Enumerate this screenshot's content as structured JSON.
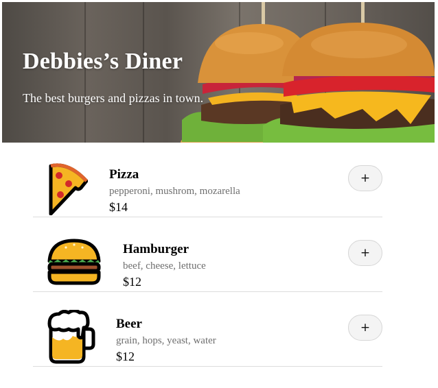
{
  "hero": {
    "title": "Debbies’s Diner",
    "subtitle": "The best burgers and pizzas in town."
  },
  "menu": {
    "items": [
      {
        "name": "Pizza",
        "description": "pepperoni, mushrom, mozarella",
        "price": "$14",
        "icon": "pizza-slice-icon",
        "add_label": "+"
      },
      {
        "name": "Hamburger",
        "description": "beef, cheese, lettuce",
        "price": "$12",
        "icon": "hamburger-icon",
        "add_label": "+"
      },
      {
        "name": "Beer",
        "description": "grain, hops, yeast, water",
        "price": "$12",
        "icon": "beer-mug-icon",
        "add_label": "+"
      }
    ]
  },
  "colors": {
    "text": "#000000",
    "muted_text": "#6e6e6e",
    "divider": "#dcdcdc",
    "button_bg": "#f4f4f4",
    "hero_text": "#ffffff"
  }
}
